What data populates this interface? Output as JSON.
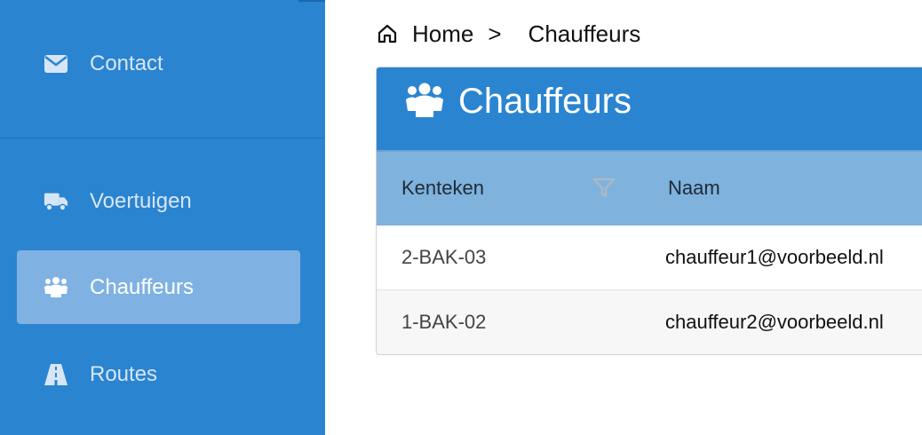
{
  "sidebar": {
    "items": [
      {
        "label": "Contact",
        "icon": "envelope-icon",
        "active": false
      },
      {
        "label": "Voertuigen",
        "icon": "truck-icon",
        "active": false
      },
      {
        "label": "Chauffeurs",
        "icon": "users-icon",
        "active": true
      },
      {
        "label": "Routes",
        "icon": "road-icon",
        "active": false
      }
    ]
  },
  "breadcrumb": {
    "home_icon": "home-icon",
    "home": "Home",
    "separator": ">",
    "current": "Chauffeurs"
  },
  "panel": {
    "title": "Chauffeurs",
    "icon": "users-icon",
    "table": {
      "headers": [
        "Kenteken",
        "Naam"
      ],
      "filter_icon": "filter-icon",
      "rows": [
        {
          "kenteken": "2-BAK-03",
          "naam": "chauffeur1@voorbeeld.nl"
        },
        {
          "kenteken": "1-BAK-02",
          "naam": "chauffeur2@voorbeeld.nl"
        }
      ]
    }
  },
  "colors": {
    "sidebar_bg": "#2b84d0",
    "active_item_bg": "#7fb2e2",
    "table_header_bg": "#7fb2dc"
  }
}
